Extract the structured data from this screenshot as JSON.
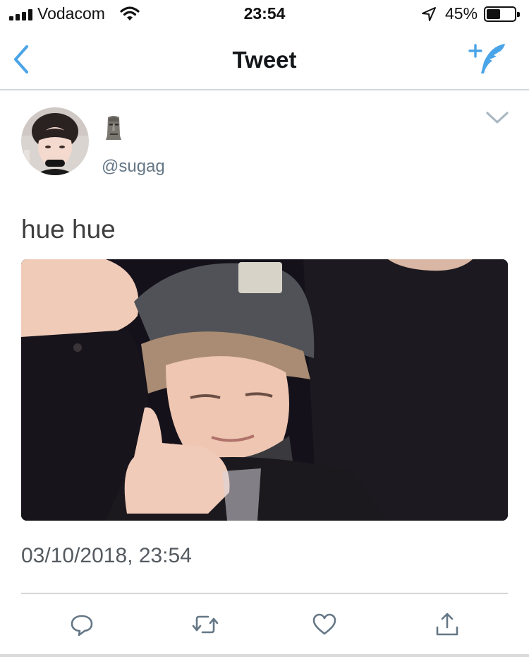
{
  "status_bar": {
    "carrier": "Vodacom",
    "time": "23:54",
    "battery_percent": "45%",
    "battery_level": 0.45
  },
  "nav": {
    "title": "Tweet",
    "back_icon": "chevron-left-icon",
    "compose_icon": "compose-feather-icon",
    "accent_color": "#4aa4e8"
  },
  "tweet": {
    "display_name_icon": "moai-emoji",
    "handle": "@sugag",
    "text": "hue hue",
    "timestamp": "03/10/2018, 23:54"
  },
  "actions": [
    {
      "name": "reply",
      "icon": "reply-bubble-icon"
    },
    {
      "name": "retweet",
      "icon": "retweet-icon"
    },
    {
      "name": "like",
      "icon": "heart-icon"
    },
    {
      "name": "share",
      "icon": "share-icon"
    }
  ],
  "colors": {
    "text_primary": "#14171a",
    "text_secondary": "#657786",
    "icon_gray": "#657786",
    "divider": "#d4d7d9"
  }
}
